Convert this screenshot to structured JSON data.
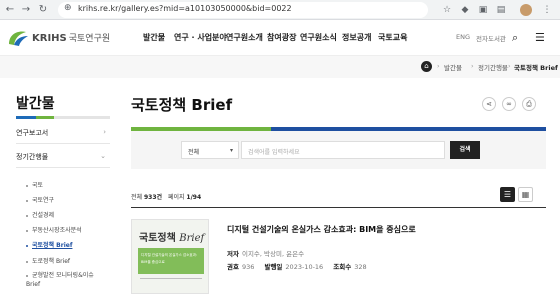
{
  "browser": {
    "url": "krihs.re.kr/gallery.es?mid=a10103050000&bid=0022"
  },
  "header": {
    "logo_text": "KRIHS",
    "logo_ko": "국토연구원",
    "nav": [
      "발간물",
      "연구 · 사업분야",
      "연구원소개",
      "참여광장",
      "연구원소식",
      "정보공개",
      "국토교육"
    ],
    "util": [
      "ENG",
      "전자도서관"
    ]
  },
  "breadcrumb": [
    "발간물",
    "정기간행물",
    "국토정책 Brief"
  ],
  "lnb": {
    "title": "발간물",
    "menu1": "연구보고서",
    "menu2": "정기간행물",
    "subs": [
      "국토",
      "국토연구",
      "건설경제",
      "부동산시장조사분석",
      "국토정책 Brief",
      "도로정책 Brief",
      "균형발전 모니터링&이슈 Brief"
    ]
  },
  "main": {
    "title": "국토정책 Brief",
    "search": {
      "select_value": "전체",
      "placeholder": "검색어를 입력하세요",
      "button": "검색"
    },
    "count_label": "전체",
    "count_value": "933건",
    "page_label": "페이지",
    "page_value": "1/94"
  },
  "item": {
    "title": "디지털 건설기술의 온실가스 감소효과: BIM을 중심으로",
    "author_label": "저자",
    "author_value": "이지수, 박상미, 윤은수",
    "no_label": "권호",
    "no_value": "936",
    "date_label": "발행일",
    "date_value": "2023-10-16",
    "views_label": "조회수",
    "views_value": "328",
    "thumb_title_ko": "국토정책",
    "thumb_title_en": "Brief",
    "thumb_lines": [
      "디지털 건설기술의 온실가스 감소효과:",
      "BIM을 중심으로"
    ]
  },
  "colors": {
    "brand_blue": "#1e4fa0",
    "brand_green": "#6fb43f"
  }
}
